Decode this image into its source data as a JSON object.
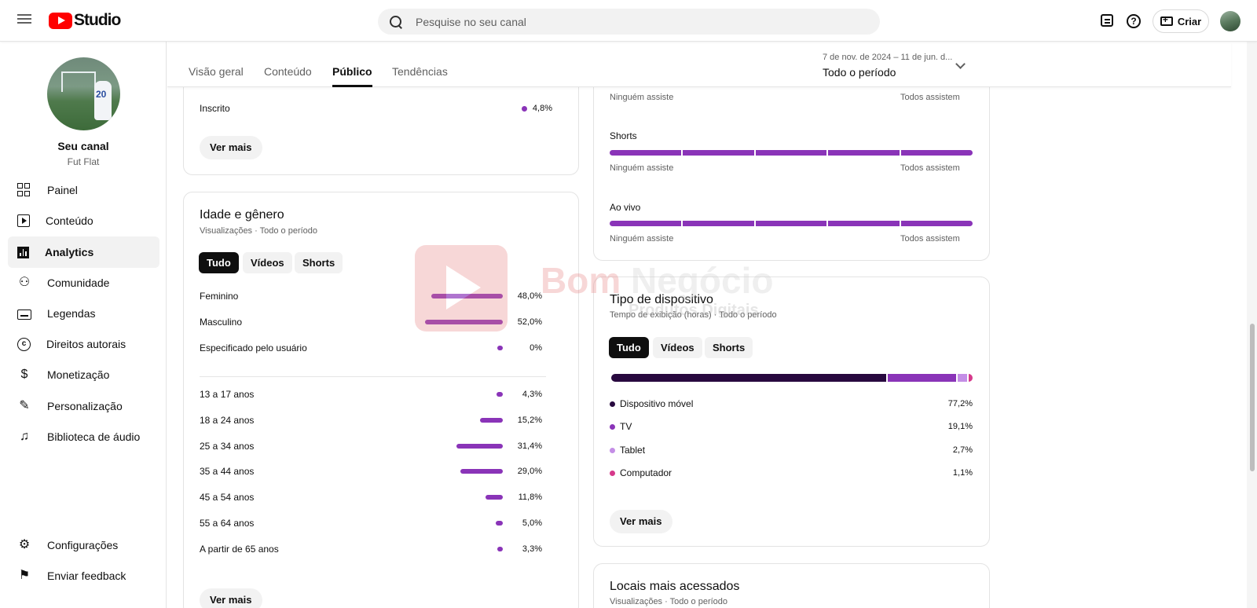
{
  "app": {
    "logo_text": "Studio"
  },
  "search": {
    "placeholder": "Pesquise no seu canal"
  },
  "toolbar": {
    "create_label": "Criar",
    "help_symbol": "?"
  },
  "channel": {
    "name": "Seu canal",
    "handle": "Fut Flat",
    "jersey_number": "20"
  },
  "sidebar": {
    "items": [
      {
        "label": "Painel",
        "icon": "dashboard-icon"
      },
      {
        "label": "Conteúdo",
        "icon": "content-icon"
      },
      {
        "label": "Analytics",
        "icon": "analytics-icon",
        "active": true
      },
      {
        "label": "Comunidade",
        "icon": "community-icon"
      },
      {
        "label": "Legendas",
        "icon": "subtitles-icon"
      },
      {
        "label": "Direitos autorais",
        "icon": "copyright-icon"
      },
      {
        "label": "Monetização",
        "icon": "monetization-icon"
      },
      {
        "label": "Personalização",
        "icon": "customization-icon"
      },
      {
        "label": "Biblioteca de áudio",
        "icon": "audio-library-icon"
      }
    ],
    "footer": [
      {
        "label": "Configurações",
        "icon": "settings-icon"
      },
      {
        "label": "Enviar feedback",
        "icon": "feedback-icon"
      }
    ]
  },
  "tabs": [
    {
      "label": "Visão geral"
    },
    {
      "label": "Conteúdo"
    },
    {
      "label": "Público",
      "active": true
    },
    {
      "label": "Tendências"
    }
  ],
  "date_range": {
    "range": "7 de nov. de 2024 – 11 de jun. d...",
    "label": "Todo o período"
  },
  "subscribed_card": {
    "row_label": "Inscrito",
    "row_value": "4,8%",
    "more_label": "Ver mais"
  },
  "age_gender": {
    "title": "Idade e gênero",
    "subtitle": "Visualizações · Todo o período",
    "chips": [
      "Tudo",
      "Vídeos",
      "Shorts"
    ],
    "gender": [
      {
        "label": "Feminino",
        "value": "48,0%",
        "pct": 48.0
      },
      {
        "label": "Masculino",
        "value": "52,0%",
        "pct": 52.0
      },
      {
        "label": "Especificado pelo usuário",
        "value": "0%",
        "pct": 0
      }
    ],
    "ages": [
      {
        "label": "13 a 17 anos",
        "value": "4,3%",
        "pct": 4.3
      },
      {
        "label": "18 a 24 anos",
        "value": "15,2%",
        "pct": 15.2
      },
      {
        "label": "25 a 34 anos",
        "value": "31,4%",
        "pct": 31.4
      },
      {
        "label": "35 a 44 anos",
        "value": "29,0%",
        "pct": 29.0
      },
      {
        "label": "45 a 54 anos",
        "value": "11,8%",
        "pct": 11.8
      },
      {
        "label": "55 a 64 anos",
        "value": "5,0%",
        "pct": 5.0
      },
      {
        "label": "A partir de 65 anos",
        "value": "3,3%",
        "pct": 3.3
      }
    ],
    "more_label": "Ver mais"
  },
  "watch_card": {
    "left_label": "Ninguém assiste",
    "right_label": "Todos assistem",
    "sections": [
      {
        "label": "Shorts"
      },
      {
        "label": "Ao vivo"
      }
    ]
  },
  "device": {
    "title": "Tipo de dispositivo",
    "subtitle": "Tempo de exibição (horas) · Todo o período",
    "chips": [
      "Tudo",
      "Vídeos",
      "Shorts"
    ],
    "rows": [
      {
        "label": "Dispositivo móvel",
        "value": "77,2%",
        "pct": 77.2,
        "color": "#28093f"
      },
      {
        "label": "TV",
        "value": "19,1%",
        "pct": 19.1,
        "color": "#8a34b8"
      },
      {
        "label": "Tablet",
        "value": "2,7%",
        "pct": 2.7,
        "color": "#c48ee6"
      },
      {
        "label": "Computador",
        "value": "1,1%",
        "pct": 1.1,
        "color": "#d6398b"
      }
    ],
    "more_label": "Ver mais"
  },
  "places": {
    "title": "Locais mais acessados",
    "subtitle": "Visualizações · Todo o período"
  },
  "watermark": {
    "brand_a": "Bom ",
    "brand_b": "Negócio",
    "sub": "Produtos Digitais"
  },
  "colors": {
    "accent": "#8a34b8",
    "brand_red": "#ff0000"
  }
}
